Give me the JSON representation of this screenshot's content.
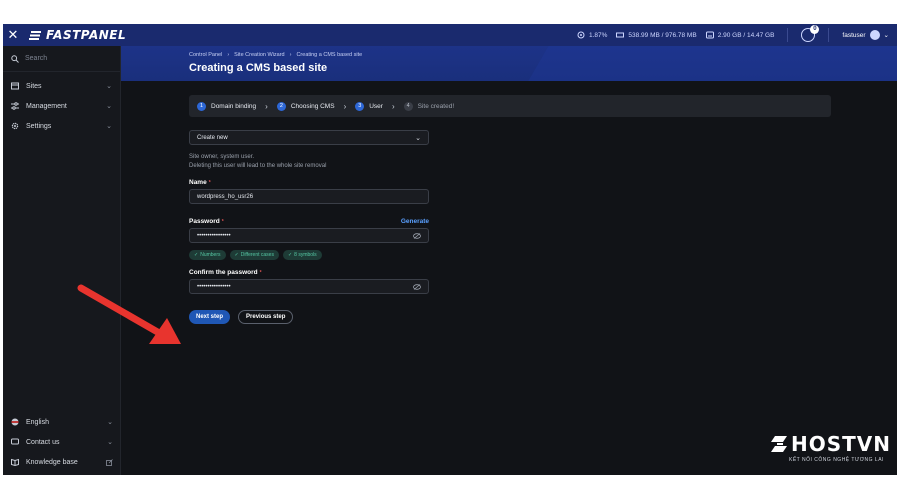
{
  "topbar": {
    "close_glyph": "✕",
    "brand": "FASTPANEL",
    "stats": {
      "cpu": "1.87%",
      "memory": "538.99 MB / 976.78 MB",
      "disk": "2.90 GB / 14.47 GB"
    },
    "notifications_count": "0",
    "username": "fastuser"
  },
  "sidebar": {
    "search_placeholder": "Search",
    "items": [
      {
        "label": "Sites",
        "icon": "sites-icon"
      },
      {
        "label": "Management",
        "icon": "sliders-icon"
      },
      {
        "label": "Settings",
        "icon": "gear-icon"
      }
    ],
    "bottom_items": [
      {
        "label": "English",
        "icon": "flag-icon"
      },
      {
        "label": "Contact us",
        "icon": "chat-icon"
      },
      {
        "label": "Knowledge base",
        "icon": "book-icon"
      }
    ]
  },
  "breadcrumb": {
    "items": [
      "Control Panel",
      "Site Creation Wizard",
      "Creating a CMS based site"
    ],
    "separator": "›"
  },
  "page_title": "Creating a CMS based site",
  "steps": [
    {
      "num": "1",
      "label": "Domain binding"
    },
    {
      "num": "2",
      "label": "Choosing CMS"
    },
    {
      "num": "3",
      "label": "User"
    },
    {
      "num": "4",
      "label": "Site created!"
    }
  ],
  "form": {
    "mode_select": "Create new",
    "note_line1": "Site owner, system user.",
    "note_line2": "Deleting this user will lead to the whole site removal",
    "name_label": "Name",
    "name_value": "wordpress_ho_usr26",
    "password_label": "Password",
    "generate_label": "Generate",
    "password_value": "••••••••••••••••",
    "chips": [
      "Numbers",
      "Different cases",
      "8 symbols"
    ],
    "confirm_label": "Confirm the password",
    "confirm_value": "••••••••••••••••",
    "required_mark": "*"
  },
  "buttons": {
    "next": "Next step",
    "previous": "Previous step"
  },
  "watermark": {
    "brand": "HOSTVN",
    "tagline": "KẾT NỐI CÔNG NGHỆ TƯƠNG LAI"
  },
  "colors": {
    "topbar": "#1a2a6e",
    "accent": "#1f57b5",
    "success": "#55c7a3",
    "arrow": "#e8342e"
  }
}
